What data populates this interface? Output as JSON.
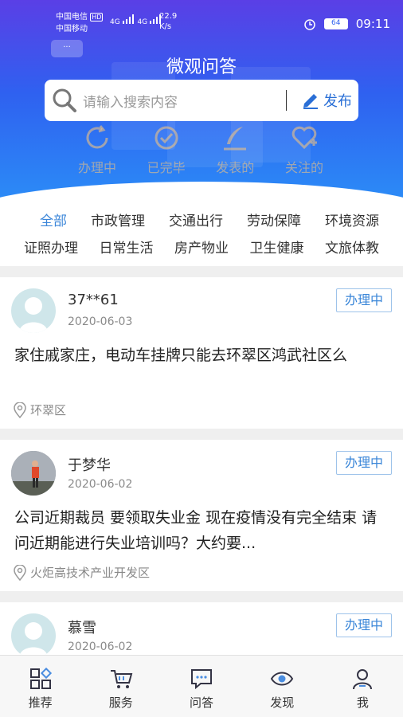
{
  "status_bar": {
    "carrier1": "中国电信",
    "carrier1_badge": "HD",
    "carrier2": "中国移动",
    "signal1": "4G",
    "signal2": "4G",
    "speed_value": "22.9",
    "speed_unit": "K/s",
    "battery": "64",
    "time": "09:11",
    "icons": [
      "alarm-icon",
      "battery-icon"
    ]
  },
  "header": {
    "title": "微观问答",
    "bubble": "···"
  },
  "search": {
    "placeholder": "请输入搜索内容",
    "publish_label": "发布",
    "icons": [
      "search-icon",
      "pencil-icon"
    ]
  },
  "quick_actions": [
    {
      "label": "办理中",
      "icon": "refresh-icon"
    },
    {
      "label": "已完毕",
      "icon": "check-circle-icon"
    },
    {
      "label": "发表的",
      "icon": "feather-pen-icon"
    },
    {
      "label": "关注的",
      "icon": "heart-plus-icon"
    }
  ],
  "categories": {
    "row1": [
      "全部",
      "市政管理",
      "交通出行",
      "劳动保障",
      "环境资源"
    ],
    "row2": [
      "证照办理",
      "日常生活",
      "房产物业",
      "卫生健康",
      "文旅体教"
    ],
    "active": "全部"
  },
  "posts": [
    {
      "user": "37**61",
      "date": "2020-06-03",
      "status": "办理中",
      "question": "家住戚家庄，电动车挂牌只能去环翠区鸿武社区么",
      "location": "环翠区",
      "avatar": "default-avatar"
    },
    {
      "user": "于梦华",
      "date": "2020-06-02",
      "status": "办理中",
      "question": "公司近期裁员  要领取失业金  现在疫情没有完全结束  请问近期能进行失业培训吗？大约要...",
      "location": "火炬高技术产业开发区",
      "avatar": "photo-avatar"
    },
    {
      "user": "慕雪",
      "date": "2020-06-02",
      "status": "办理中",
      "avatar": "default-avatar"
    }
  ],
  "tabbar": [
    {
      "label": "推荐",
      "icon": "grid-icon"
    },
    {
      "label": "服务",
      "icon": "cart-icon"
    },
    {
      "label": "问答",
      "icon": "chat-icon"
    },
    {
      "label": "发现",
      "icon": "eye-icon"
    },
    {
      "label": "我",
      "icon": "user-icon"
    }
  ],
  "colors": {
    "header_top": "#5a3fe6",
    "header_bottom": "#2b8ef7",
    "accent_blue": "#3b86d9",
    "badge_border": "#9ec3ea"
  }
}
